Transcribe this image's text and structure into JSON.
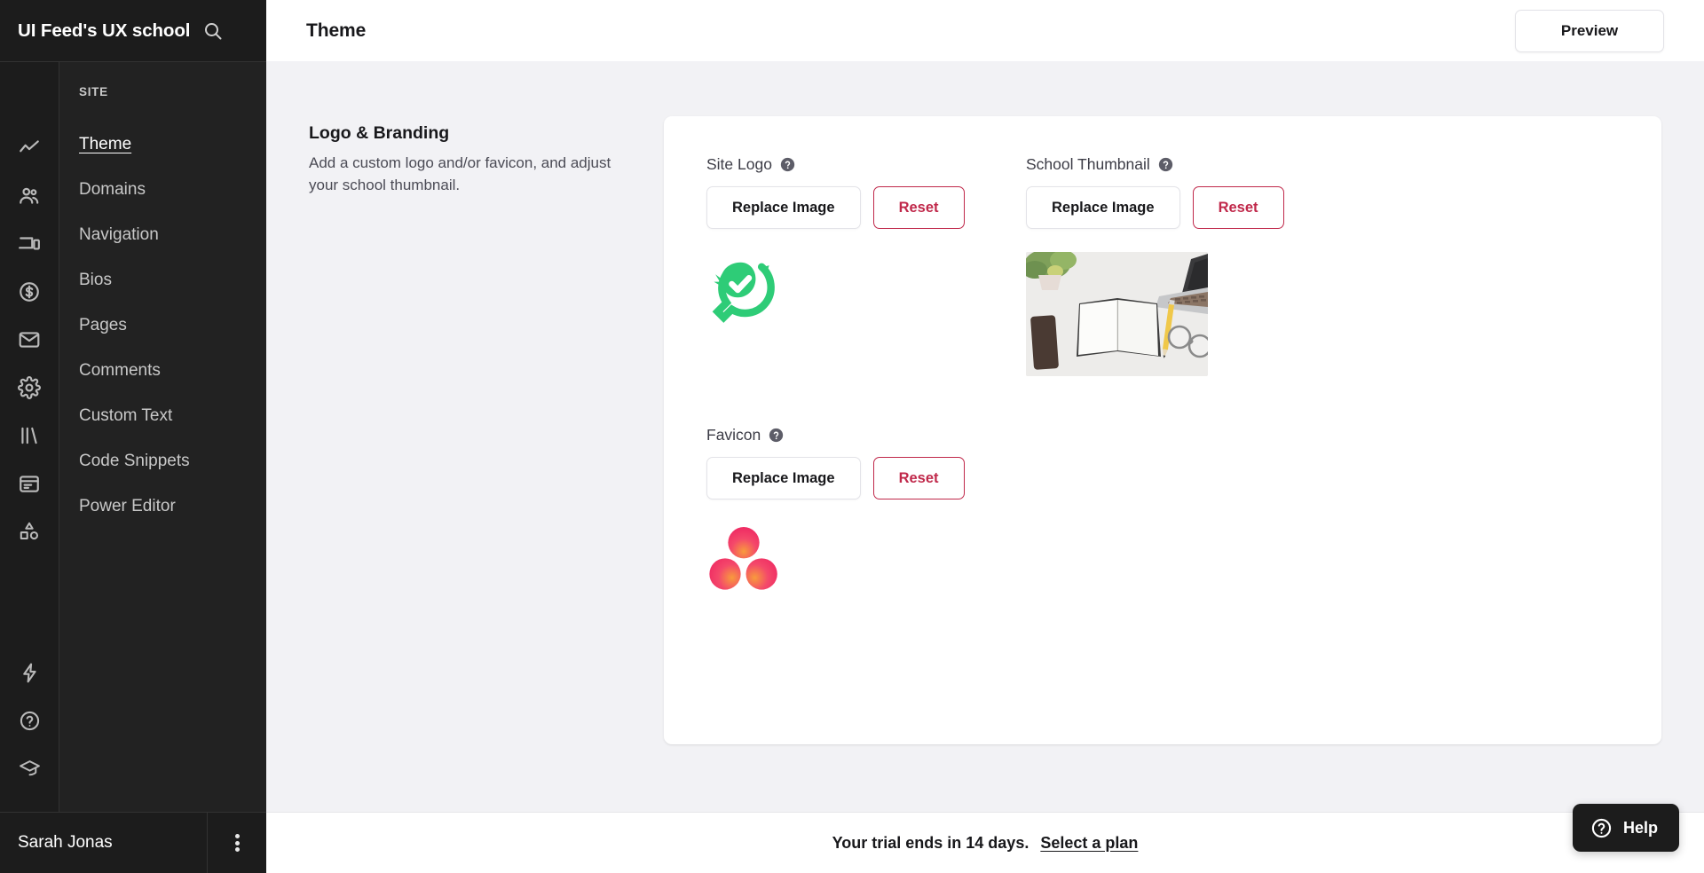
{
  "sidebar": {
    "brand_title": "UI Feed's UX school",
    "search_icon": "search-icon",
    "rail_icons": [
      {
        "name": "analytics-icon"
      },
      {
        "name": "people-icon"
      },
      {
        "name": "devices-icon"
      },
      {
        "name": "dollar-circle-icon"
      },
      {
        "name": "mail-icon"
      },
      {
        "name": "gear-icon"
      },
      {
        "name": "books-icon"
      },
      {
        "name": "calendar-icon"
      },
      {
        "name": "shapes-icon"
      }
    ],
    "rail_bottom_icons": [
      {
        "name": "lightning-icon"
      },
      {
        "name": "help-circle-icon"
      },
      {
        "name": "graduation-cap-icon"
      }
    ],
    "section_label": "SITE",
    "items": [
      {
        "label": "Theme",
        "active": true
      },
      {
        "label": "Domains",
        "active": false
      },
      {
        "label": "Navigation",
        "active": false
      },
      {
        "label": "Bios",
        "active": false
      },
      {
        "label": "Pages",
        "active": false
      },
      {
        "label": "Comments",
        "active": false
      },
      {
        "label": "Custom Text",
        "active": false
      },
      {
        "label": "Code Snippets",
        "active": false
      },
      {
        "label": "Power Editor",
        "active": false
      }
    ],
    "user_name": "Sarah Jonas",
    "kebab_icon": "more-vertical-icon"
  },
  "topbar": {
    "title": "Theme",
    "preview_label": "Preview"
  },
  "section": {
    "title": "Logo & Branding",
    "description": "Add a custom logo and/or favicon, and adjust your school thumbnail."
  },
  "fields": {
    "site_logo": {
      "label": "Site Logo",
      "replace_label": "Replace Image",
      "reset_label": "Reset",
      "preview": "green-leaf-check-logo"
    },
    "school_thumbnail": {
      "label": "School Thumbnail",
      "replace_label": "Replace Image",
      "reset_label": "Reset",
      "preview": "desk-notebook-photo"
    },
    "favicon": {
      "label": "Favicon",
      "replace_label": "Replace Image",
      "reset_label": "Reset",
      "preview": "three-gradient-circles-favicon"
    }
  },
  "trial": {
    "message": "Your trial ends in 14 days.",
    "link_label": "Select a plan"
  },
  "help": {
    "label": "Help",
    "icon": "help-circle-icon"
  },
  "colors": {
    "sidebar_bg": "#1c1c1c",
    "nav_panel_bg": "#222222",
    "page_bg": "#f2f2f5",
    "card_bg": "#ffffff",
    "danger": "#c0284a",
    "logo_green": "#2ecc77",
    "favicon_pink": "#f2406a",
    "favicon_orange": "#f89b3c"
  }
}
